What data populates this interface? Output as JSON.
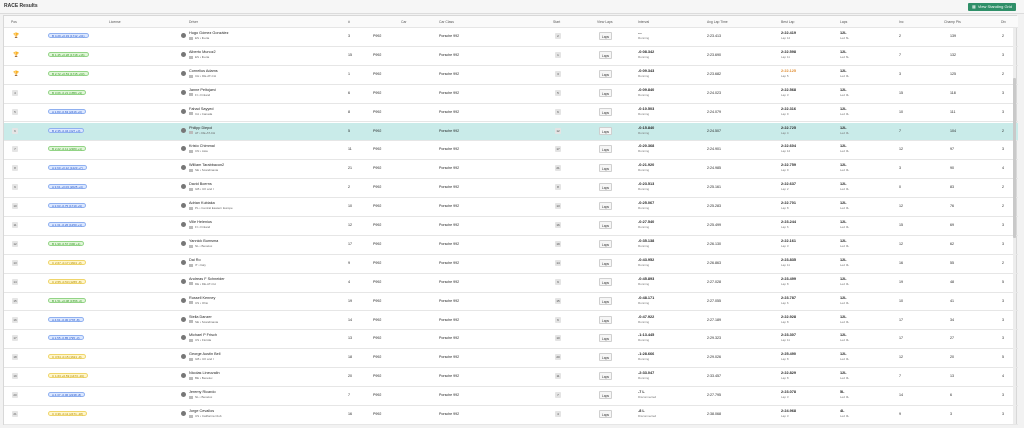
{
  "page": {
    "title": "RACE Results",
    "view_standing_label": "View Standing Grid"
  },
  "columns": {
    "pos": "Pos",
    "license": "License",
    "driver": "Driver",
    "num": "#",
    "car": "Car",
    "car_class": "Car Class",
    "start": "Start",
    "view_laps": "View Laps",
    "interval": "Interval",
    "avg_lap": "Avg Lap Time",
    "best_lap": "Best Lap",
    "laps": "Laps",
    "inc": "Inc",
    "champ_pts": "Champ Pts",
    "div": "Div"
  },
  "laps_button_label": "Laps",
  "colors": {
    "highlight_row": "#c9ebe9",
    "license_A": "#3c9a2d",
    "license_B": "#2a58c9",
    "license_C": "#b08b00",
    "best_lap_purple_or_orange": "#e08a2c"
  },
  "rows": [
    {
      "pos": "1",
      "trophy": "gold",
      "lic_class": "B",
      "license": "B 4.29 +0.33 (1712 +61)",
      "name": "Hugo Gómez González",
      "club": "ES • Iberia",
      "num": "3",
      "car": "P992",
      "car_class": "Porsche 992",
      "start": "2",
      "interval": "---",
      "status": "Running",
      "avg": "2:23.413",
      "best": "2:22.419",
      "best_lap_no": "Lap 12",
      "laps": "12L",
      "laps_sub": "Led 6L",
      "inc": "2",
      "pts": "139",
      "div": "2",
      "best_orange": false
    },
    {
      "pos": "2",
      "trophy": "silver",
      "lic_class": "A",
      "license": "B 1.45 +0.28 (1718 +16)",
      "name": "Alberto Munoz2",
      "club": "ES • Iberia",
      "num": "15",
      "car": "P992",
      "car_class": "Porsche 992",
      "start": "1",
      "interval": "-0:08.342",
      "status": "Running",
      "avg": "2:23.690",
      "best": "2:22.598",
      "best_lap_no": "Lap 11",
      "laps": "12L",
      "laps_sub": "Led 6L",
      "inc": "7",
      "pts": "132",
      "div": "3",
      "best_orange": false
    },
    {
      "pos": "3",
      "trophy": "bronze",
      "lic_class": "A",
      "license": "B 2.72 +0.53 (1715 +63)",
      "name": "Cornelius Adams",
      "club": "CH • DE-AT-CH",
      "num": "1",
      "car": "P992",
      "car_class": "Porsche 992",
      "start": "3",
      "interval": "-0:09.343",
      "status": "Running",
      "avg": "2:23.682",
      "best": "2:22.125",
      "best_lap_no": "Lap 5",
      "laps": "12L",
      "laps_sub": "Led 0L",
      "inc": "3",
      "pts": "125",
      "div": "2",
      "best_orange": true
    },
    {
      "pos": "4",
      "trophy": "",
      "lic_class": "A",
      "license": "B 3.06 -0.21 (1856 +9)",
      "name": "Janne Peltojarvi",
      "club": "FI • Finland",
      "num": "6",
      "car": "P992",
      "car_class": "Porsche 992",
      "start": "5",
      "interval": "-0:09.840",
      "status": "Running",
      "avg": "2:24.023",
      "best": "2:22.568",
      "best_lap_no": "Lap 3",
      "laps": "12L",
      "laps_sub": "Led 0L",
      "inc": "15",
      "pts": "118",
      "div": "3",
      "best_orange": false
    },
    {
      "pos": "5",
      "trophy": "",
      "lic_class": "B",
      "license": "A 1.83 -0.63 (2416 +0)",
      "name": "Fahad Sayyed",
      "club": "CA • Canada",
      "num": "8",
      "car": "P992",
      "car_class": "Porsche 992",
      "start": "6",
      "interval": "-0:10.503",
      "status": "Running",
      "avg": "2:24.079",
      "best": "2:22.316",
      "best_lap_no": "Lap 9",
      "laps": "12L",
      "laps_sub": "Led 0L",
      "inc": "10",
      "pts": "111",
      "div": "3",
      "best_orange": false
    },
    {
      "pos": "6",
      "trophy": "",
      "lic_class": "B",
      "license": "B 2.35 -0.04 (327 +0)",
      "name": "Philipp Diepol",
      "club": "AT • DE-AT-CH",
      "num": "5",
      "car": "P992",
      "car_class": "Porsche 992",
      "start": "12",
      "interval": "-0:15.840",
      "status": "Running",
      "avg": "2:24.507",
      "best": "2:22.725",
      "best_lap_no": "Lap 4",
      "laps": "12L",
      "laps_sub": "Led 0L",
      "inc": "7",
      "pts": "104",
      "div": "2",
      "best_orange": false,
      "highlight": true
    },
    {
      "pos": "7",
      "trophy": "",
      "lic_class": "A",
      "license": "B 2.22 -0.11 (2380 +1)",
      "name": "Kristo Chimmal",
      "club": "CN • Asia",
      "num": "11",
      "car": "P992",
      "car_class": "Porsche 992",
      "start": "17",
      "interval": "-0:20.368",
      "status": "Running",
      "avg": "2:24.901",
      "best": "2:22.604",
      "best_lap_no": "Lap 12",
      "laps": "12L",
      "laps_sub": "Led 0L",
      "inc": "12",
      "pts": "97",
      "div": "3",
      "best_orange": false
    },
    {
      "pos": "8",
      "trophy": "",
      "lic_class": "B",
      "license": "A 2.60 +0.12 (1423 +7)",
      "name": "William Tarabbacon2",
      "club": "SE • Scandinavia",
      "num": "21",
      "car": "P992",
      "car_class": "Porsche 992",
      "start": "21",
      "interval": "-0:21.920",
      "status": "Running",
      "avg": "2:24.985",
      "best": "2:22.759",
      "best_lap_no": "Lap 9",
      "laps": "12L",
      "laps_sub": "Led 0L",
      "inc": "3",
      "pts": "90",
      "div": "4",
      "best_orange": false
    },
    {
      "pos": "9",
      "trophy": "",
      "lic_class": "B",
      "license": "A 3.61 +0.03 (2025 +4)",
      "name": "David Boerns",
      "club": "GB • UK and I",
      "num": "2",
      "car": "P992",
      "car_class": "Porsche 992",
      "start": "8",
      "interval": "-0:23.513",
      "status": "Running",
      "avg": "2:25.161",
      "best": "2:22.637",
      "best_lap_no": "Lap 2",
      "laps": "12L",
      "laps_sub": "Led 0L",
      "inc": "0",
      "pts": "83",
      "div": "2",
      "best_orange": false
    },
    {
      "pos": "10",
      "trophy": "",
      "lic_class": "B",
      "license": "A 2.93 -0.75 (1719 +9)",
      "name": "Adrian Kubiaka",
      "club": "PL • Central Eastern Europe",
      "num": "10",
      "car": "P992",
      "car_class": "Porsche 992",
      "start": "13",
      "interval": "-0:25.067",
      "status": "Running",
      "avg": "2:25.283",
      "best": "2:22.701",
      "best_lap_no": "Lap 8",
      "laps": "12L",
      "laps_sub": "Led 0L",
      "inc": "12",
      "pts": "76",
      "div": "2",
      "best_orange": false
    },
    {
      "pos": "11",
      "trophy": "",
      "lic_class": "B",
      "license": "A 1.31 -0.26 (1250 +1)",
      "name": "Ville Helenius",
      "club": "FI • Finland",
      "num": "12",
      "car": "P992",
      "car_class": "Porsche 992",
      "start": "16",
      "interval": "-0:27.540",
      "status": "Running",
      "avg": "2:25.499",
      "best": "2:23.244",
      "best_lap_no": "Lap 6",
      "laps": "12L",
      "laps_sub": "Led 0L",
      "inc": "15",
      "pts": "69",
      "div": "3",
      "best_orange": false
    },
    {
      "pos": "12",
      "trophy": "",
      "lic_class": "A",
      "license": "B 1.99 -0.57 (990 +1)",
      "name": "Yannick Bumsma",
      "club": "NL • Benelux",
      "num": "17",
      "car": "P992",
      "car_class": "Porsche 992",
      "start": "19",
      "interval": "-0:35.138",
      "status": "Running",
      "avg": "2:26.130",
      "best": "2:22.161",
      "best_lap_no": "Lap 3",
      "laps": "12L",
      "laps_sub": "Led 0L",
      "inc": "12",
      "pts": "62",
      "div": "3",
      "best_orange": false
    },
    {
      "pos": "13",
      "trophy": "",
      "lic_class": "C",
      "license": "C 2.67 -0.17 (1601 -3)",
      "name": "Dai Ro",
      "club": "IT • Italy",
      "num": "9",
      "car": "P992",
      "car_class": "Porsche 992",
      "start": "14",
      "interval": "-0:43.952",
      "status": "Running",
      "avg": "2:26.863",
      "best": "2:23.835",
      "best_lap_no": "Lap 11",
      "laps": "12L",
      "laps_sub": "Led 0L",
      "inc": "16",
      "pts": "55",
      "div": "2",
      "best_orange": false
    },
    {
      "pos": "14",
      "trophy": "",
      "lic_class": "C",
      "license": "C 2.55 -0.53 (1265 -8)",
      "name": "Andreas F Schneider",
      "club": "DE • DE-AT-CH",
      "num": "4",
      "car": "P992",
      "car_class": "Porsche 992",
      "start": "9",
      "interval": "-0:45.893",
      "status": "Running",
      "avg": "2:27.028",
      "best": "2:23.499",
      "best_lap_no": "Lap 8",
      "laps": "12L",
      "laps_sub": "Led 0L",
      "inc": "19",
      "pts": "48",
      "div": "5",
      "best_orange": false
    },
    {
      "pos": "15",
      "trophy": "",
      "lic_class": "A",
      "license": "B 1.51 +0.08 (1556 -2)",
      "name": "Russell Kenney",
      "club": "US • Ohio",
      "num": "19",
      "car": "P992",
      "car_class": "Porsche 992",
      "start": "15",
      "interval": "-0:48.171",
      "status": "Running",
      "avg": "2:27.055",
      "best": "2:23.787",
      "best_lap_no": "Lap 6",
      "laps": "12L",
      "laps_sub": "Led 0L",
      "inc": "10",
      "pts": "41",
      "div": "3",
      "best_orange": false
    },
    {
      "pos": "16",
      "trophy": "",
      "lic_class": "B",
      "license": "A 4.61 -0.30 (778 -8)",
      "name": "Stella Danzer",
      "club": "SE • Scandinavia",
      "num": "14",
      "car": "P992",
      "car_class": "Porsche 992",
      "start": "6",
      "interval": "-0:47.922",
      "status": "Running",
      "avg": "2:27.189",
      "best": "2:22.928",
      "best_lap_no": "Lap 8",
      "laps": "12L",
      "laps_sub": "Led 0L",
      "inc": "17",
      "pts": "34",
      "div": "3",
      "best_orange": false
    },
    {
      "pos": "17",
      "trophy": "",
      "lic_class": "B",
      "license": "A 1.55 -0.85 (795 -3)",
      "name": "Michael P Frisch",
      "club": "US • Florida",
      "num": "13",
      "car": "P992",
      "car_class": "Porsche 992",
      "start": "10",
      "interval": "-1:13.445",
      "status": "Running",
      "avg": "2:29.323",
      "best": "2:23.307",
      "best_lap_no": "Lap 11",
      "laps": "12L",
      "laps_sub": "Led 0L",
      "inc": "17",
      "pts": "27",
      "div": "3",
      "best_orange": false
    },
    {
      "pos": "18",
      "trophy": "",
      "lic_class": "C",
      "license": "C 3.54 -0.15 (1621 -9)",
      "name": "George Austin Bell",
      "club": "GB • UK and I",
      "num": "18",
      "car": "P992",
      "car_class": "Porsche 992",
      "start": "20",
      "interval": "-1:28.666",
      "status": "Running",
      "avg": "2:29.026",
      "best": "2:25.490",
      "best_lap_no": "Lap 8",
      "laps": "12L",
      "laps_sub": "Led 0L",
      "inc": "12",
      "pts": "20",
      "div": "5",
      "best_orange": false
    },
    {
      "pos": "19",
      "trophy": "",
      "lic_class": "C",
      "license": "C 1.63 +0.59 (1473 -16)",
      "name": "Nicolas Lineuvalin",
      "club": "BE • Benelux",
      "num": "20",
      "car": "P992",
      "car_class": "Porsche 992",
      "start": "11",
      "interval": "-2:33.047",
      "status": "Running",
      "avg": "2:33.457",
      "best": "2:22.829",
      "best_lap_no": "Lap 8",
      "laps": "12L",
      "laps_sub": "Led 0L",
      "inc": "7",
      "pts": "13",
      "div": "4",
      "best_orange": false
    },
    {
      "pos": "20",
      "trophy": "",
      "lic_class": "B",
      "license": "A 4.37 -0.06 (2238 -8)",
      "name": "Jeremy Ricardo",
      "club": "NL • Benelux",
      "num": "7",
      "car": "P992",
      "car_class": "Porsche 992",
      "start": "7",
      "interval": "-7 L",
      "status": "Disconnected",
      "avg": "2:27.795",
      "best": "2:23.078",
      "best_lap_no": "Lap 3",
      "laps": "5L",
      "laps_sub": "Led 0L",
      "inc": "14",
      "pts": "6",
      "div": "3",
      "best_orange": false
    },
    {
      "pos": "21",
      "trophy": "",
      "lic_class": "C",
      "license": "C 3.36 -0.11 (2471 -18)",
      "name": "Jorge Cevallos",
      "club": "US • California Club",
      "num": "16",
      "car": "P992",
      "car_class": "Porsche 992",
      "start": "4",
      "interval": "-8 L",
      "status": "Disconnected",
      "avg": "2:38.068",
      "best": "2:24.968",
      "best_lap_no": "Lap 3",
      "laps": "4L",
      "laps_sub": "Led 0L",
      "inc": "9",
      "pts": "3",
      "div": "3",
      "best_orange": false
    }
  ]
}
